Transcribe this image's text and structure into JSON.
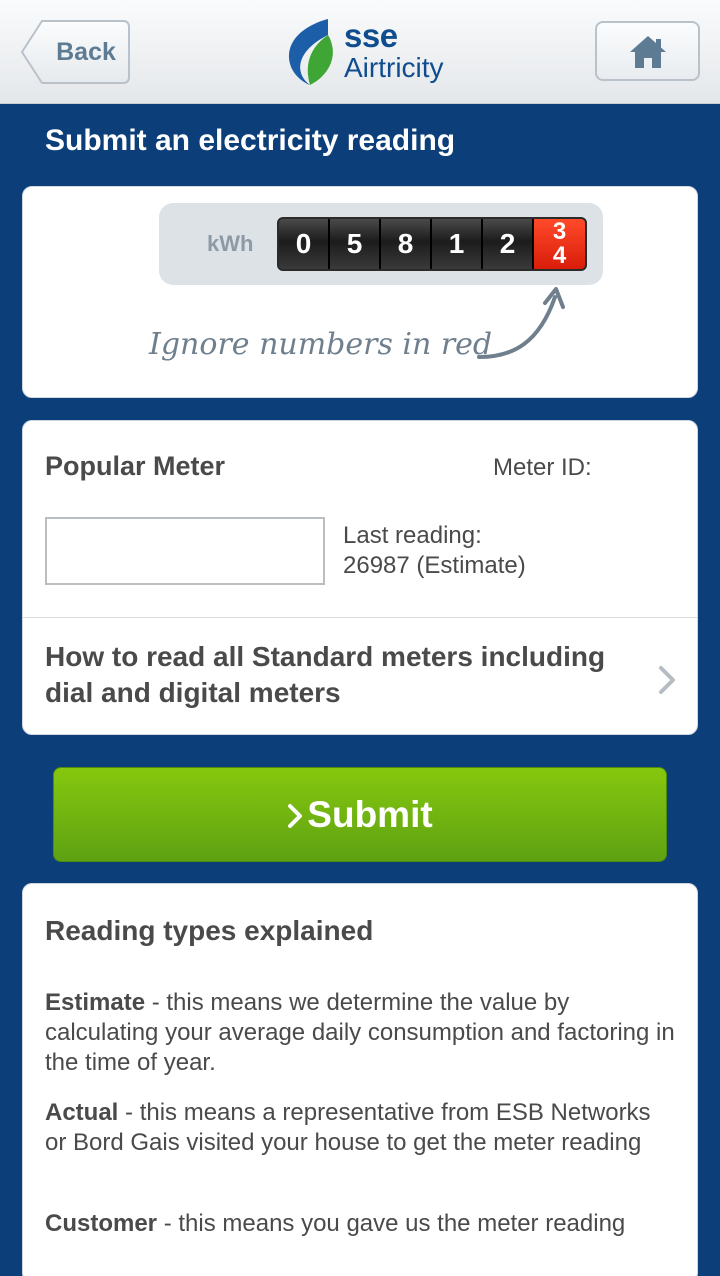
{
  "header": {
    "back_label": "Back",
    "logo_brand": "sse",
    "logo_sub": "Airtricity",
    "home_icon": "home-icon"
  },
  "page_title": "Submit an electricity reading",
  "meter_illustration": {
    "unit": "kWh",
    "digits": [
      "0",
      "5",
      "8",
      "1",
      "2"
    ],
    "red_digits": [
      "3",
      "4"
    ],
    "note": "Ignore numbers in red"
  },
  "meter": {
    "name": "Popular Meter",
    "id_label": "Meter ID:",
    "input_value": "",
    "last_reading_label": "Last reading:",
    "last_reading_value": "26987 (Estimate)",
    "how_to_link": "How to read all Standard meters including dial and digital meters"
  },
  "submit": {
    "label": "Submit",
    "icon": "chevron-right-icon"
  },
  "reading_types": {
    "title": "Reading types explained",
    "items": [
      {
        "term": "Estimate",
        "text": " - this means we determine the value by calculating your average daily consumption and factoring in the time of year."
      },
      {
        "term": "Actual",
        "text": " - this means a representative from ESB Networks or Bord Gais visited your house to get the meter reading"
      },
      {
        "term": "Customer",
        "text": " - this means you gave us the meter reading"
      }
    ]
  },
  "colors": {
    "background": "#0c3f7a",
    "submit_green": "#6db310",
    "brand_blue": "#0f4d8f",
    "meter_red": "#e62a12"
  }
}
